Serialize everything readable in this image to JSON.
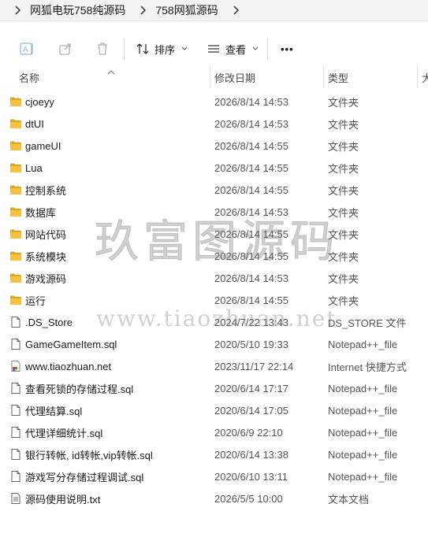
{
  "breadcrumb": [
    "网狐电玩758纯源码",
    "758网狐源码"
  ],
  "toolbar": {
    "sort_label": "排序",
    "view_label": "查看",
    "more_label": "•••"
  },
  "columns": {
    "name": "名称",
    "date": "修改日期",
    "type": "类型",
    "size": "大"
  },
  "files": [
    {
      "name": "cjoeyy",
      "date": "2026/8/14 14:53",
      "type": "文件夹",
      "icon": "folder-icon"
    },
    {
      "name": "dtUI",
      "date": "2026/8/14 14:53",
      "type": "文件夹",
      "icon": "folder-icon"
    },
    {
      "name": "gameUI",
      "date": "2026/8/14 14:55",
      "type": "文件夹",
      "icon": "folder-icon"
    },
    {
      "name": "Lua",
      "date": "2026/8/14 14:55",
      "type": "文件夹",
      "icon": "folder-icon"
    },
    {
      "name": "控制系统",
      "date": "2026/8/14 14:55",
      "type": "文件夹",
      "icon": "folder-icon"
    },
    {
      "name": "数据库",
      "date": "2026/8/14 14:53",
      "type": "文件夹",
      "icon": "folder-icon"
    },
    {
      "name": "网站代码",
      "date": "2026/8/14 14:55",
      "type": "文件夹",
      "icon": "folder-icon"
    },
    {
      "name": "系统模块",
      "date": "2026/8/14 14:55",
      "type": "文件夹",
      "icon": "folder-icon"
    },
    {
      "name": "游戏源码",
      "date": "2026/8/14 14:53",
      "type": "文件夹",
      "icon": "folder-icon"
    },
    {
      "name": "运行",
      "date": "2026/8/14 14:55",
      "type": "文件夹",
      "icon": "folder-icon"
    },
    {
      "name": ".DS_Store",
      "date": "2024/7/22 13:43",
      "type": "DS_STORE 文件",
      "icon": "file-icon"
    },
    {
      "name": "GameGameItem.sql",
      "date": "2020/5/10 19:33",
      "type": "Notepad++_file",
      "icon": "file-icon"
    },
    {
      "name": "www.tiaozhuan.net",
      "date": "2023/11/17 22:14",
      "type": "Internet 快捷方式",
      "icon": "internet-shortcut-icon"
    },
    {
      "name": "查看死锁的存储过程.sql",
      "date": "2020/6/14 17:17",
      "type": "Notepad++_file",
      "icon": "file-icon"
    },
    {
      "name": "代理结算.sql",
      "date": "2020/6/14 17:05",
      "type": "Notepad++_file",
      "icon": "file-icon"
    },
    {
      "name": "代理详细统计.sql",
      "date": "2020/6/9 22:10",
      "type": "Notepad++_file",
      "icon": "file-icon"
    },
    {
      "name": "银行转帐, id转帐,vip转帐.sql",
      "date": "2020/6/14 13:38",
      "type": "Notepad++_file",
      "icon": "file-icon"
    },
    {
      "name": "游戏写分存储过程调试.sql",
      "date": "2020/6/10 13:11",
      "type": "Notepad++_file",
      "icon": "file-icon"
    },
    {
      "name": "源码使用说明.txt",
      "date": "2026/5/5 10:00",
      "type": "文本文档",
      "icon": "text-file-icon"
    }
  ],
  "watermark": {
    "line1": "玖富图源码",
    "line2": "www.tiaozhuan.net"
  },
  "colors": {
    "folder": "#f4c23d",
    "folder_dark": "#e0a82b",
    "accent": "#0067c0"
  }
}
